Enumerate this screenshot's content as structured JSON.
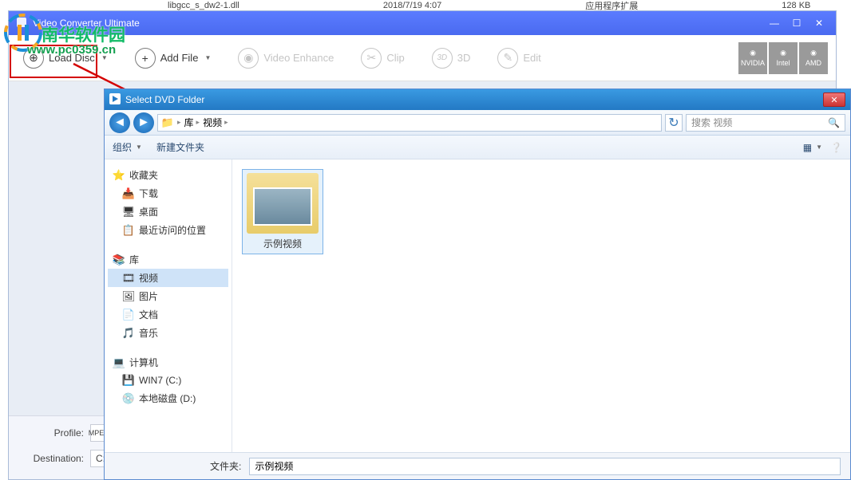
{
  "bg_row": {
    "name": "libgcc_s_dw2-1.dll",
    "date": "2018/7/19 4:07",
    "type": "应用程序扩展",
    "size": "128 KB"
  },
  "app": {
    "title": "Video Converter Ultimate",
    "toolbar": {
      "load_disc": "Load Disc",
      "add_file": "Add File",
      "video_enhance": "Video Enhance",
      "clip": "Clip",
      "three_d": "3D",
      "edit": "Edit"
    },
    "badges": {
      "nvidia": "NVIDIA",
      "intel": "Intel",
      "amd": "AMD"
    },
    "bottom": {
      "profile_label": "Profile:",
      "destination_label": "Destination:",
      "destination_value": "C:\\"
    }
  },
  "dialog": {
    "title": "Select DVD Folder",
    "breadcrumb": {
      "seg1": "库",
      "seg2": "视频"
    },
    "search_placeholder": "搜索 视频",
    "tools": {
      "organize": "组织",
      "new_folder": "新建文件夹"
    },
    "tree": {
      "favorites": "收藏夹",
      "downloads": "下载",
      "desktop": "桌面",
      "recent": "最近访问的位置",
      "libraries": "库",
      "videos": "视频",
      "pictures": "图片",
      "documents": "文档",
      "music": "音乐",
      "computer": "计算机",
      "drive_c": "WIN7 (C:)",
      "drive_d": "本地磁盘 (D:)"
    },
    "folder": {
      "name": "示例视频"
    },
    "footer": {
      "label": "文件夹:",
      "value": "示例视频"
    }
  },
  "watermark": {
    "text1": "南华软件园",
    "text2": "www.pc0359.cn"
  }
}
